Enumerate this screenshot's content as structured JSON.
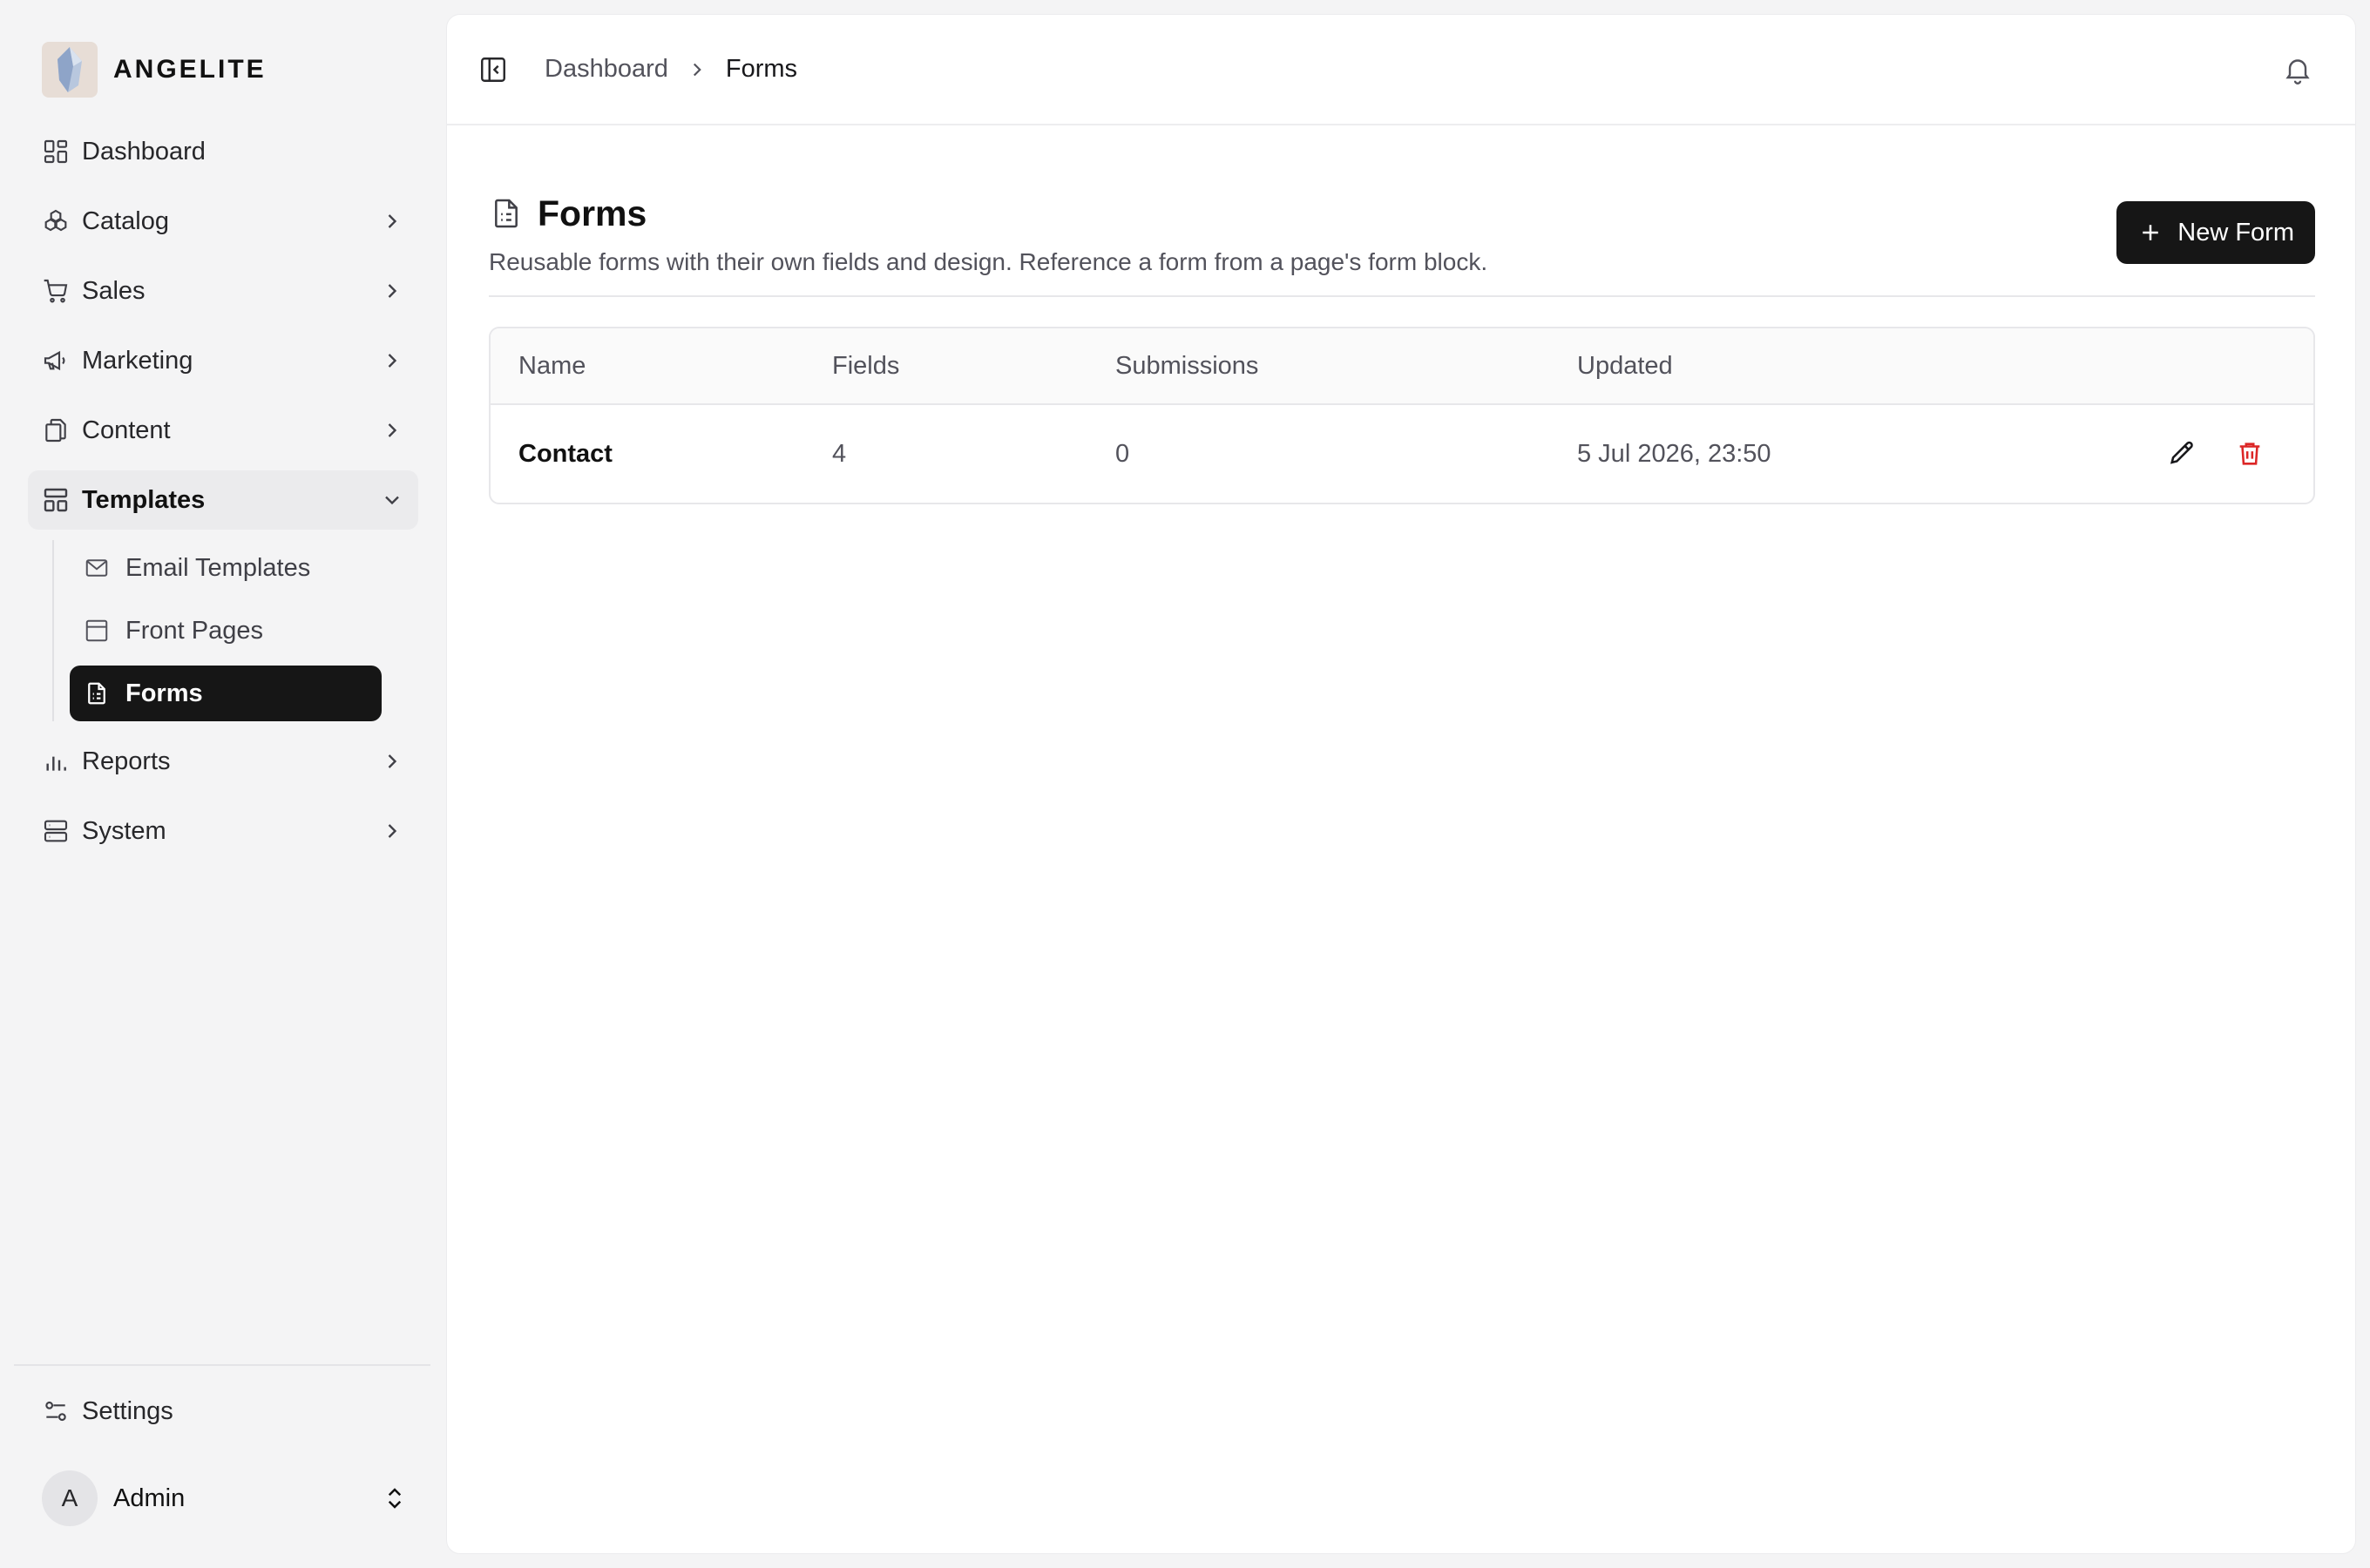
{
  "brand": {
    "name": "ANGELITE"
  },
  "sidebar": {
    "items": [
      {
        "label": "Dashboard",
        "icon": "dashboard-icon"
      },
      {
        "label": "Catalog",
        "icon": "catalog-icon"
      },
      {
        "label": "Sales",
        "icon": "cart-icon"
      },
      {
        "label": "Marketing",
        "icon": "megaphone-icon"
      },
      {
        "label": "Content",
        "icon": "files-icon"
      },
      {
        "label": "Templates",
        "icon": "layout-icon"
      },
      {
        "label": "Reports",
        "icon": "bar-chart-icon"
      },
      {
        "label": "System",
        "icon": "server-icon"
      }
    ],
    "templates_children": [
      {
        "label": "Email Templates",
        "icon": "mail-icon"
      },
      {
        "label": "Front Pages",
        "icon": "window-icon"
      },
      {
        "label": "Forms",
        "icon": "form-icon",
        "active": true
      }
    ],
    "settings_label": "Settings",
    "user": {
      "initial": "A",
      "name": "Admin"
    }
  },
  "breadcrumb": {
    "parent": "Dashboard",
    "current": "Forms"
  },
  "page": {
    "title": "Forms",
    "description": "Reusable forms with their own fields and design. Reference a form from a page's form block.",
    "new_button": "New Form"
  },
  "table": {
    "columns": [
      "Name",
      "Fields",
      "Submissions",
      "Updated"
    ],
    "rows": [
      {
        "name": "Contact",
        "fields": "4",
        "submissions": "0",
        "updated": "5 Jul 2026, 23:50"
      }
    ]
  },
  "colors": {
    "accent": "#161616",
    "danger": "#dc2626",
    "background": "#f4f4f5"
  }
}
